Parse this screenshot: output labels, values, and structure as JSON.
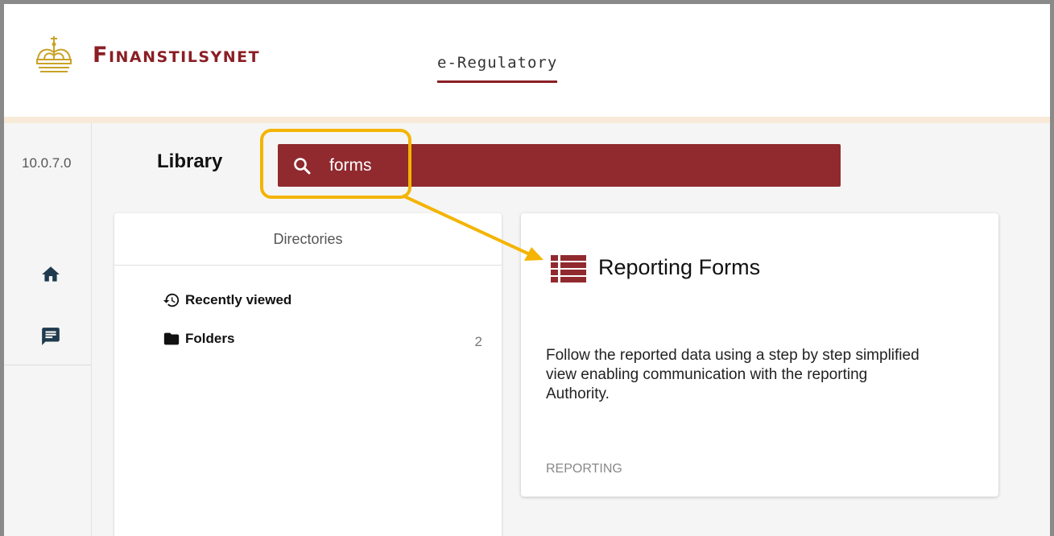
{
  "header": {
    "brand": "Finanstilsynet",
    "nav_tab": "e-Regulatory"
  },
  "rail": {
    "version": "10.0.7.0",
    "items": [
      {
        "icon": "home-icon"
      },
      {
        "icon": "chat-icon"
      }
    ]
  },
  "library": {
    "title": "Library",
    "search_value": "forms"
  },
  "directories": {
    "header": "Directories",
    "items": [
      {
        "label": "Recently viewed",
        "icon": "history-icon"
      },
      {
        "label": "Folders",
        "icon": "folder-icon",
        "count": "2"
      }
    ]
  },
  "result_card": {
    "title": "Reporting Forms",
    "icon": "reporting-forms-icon",
    "description": "Follow the reported data using a step by step simplified view enabling communication with the reporting Authority.",
    "tag": "REPORTING"
  },
  "colors": {
    "brand": "#8a1f25",
    "search_bg": "#902a2f",
    "highlight": "#f4b400"
  }
}
